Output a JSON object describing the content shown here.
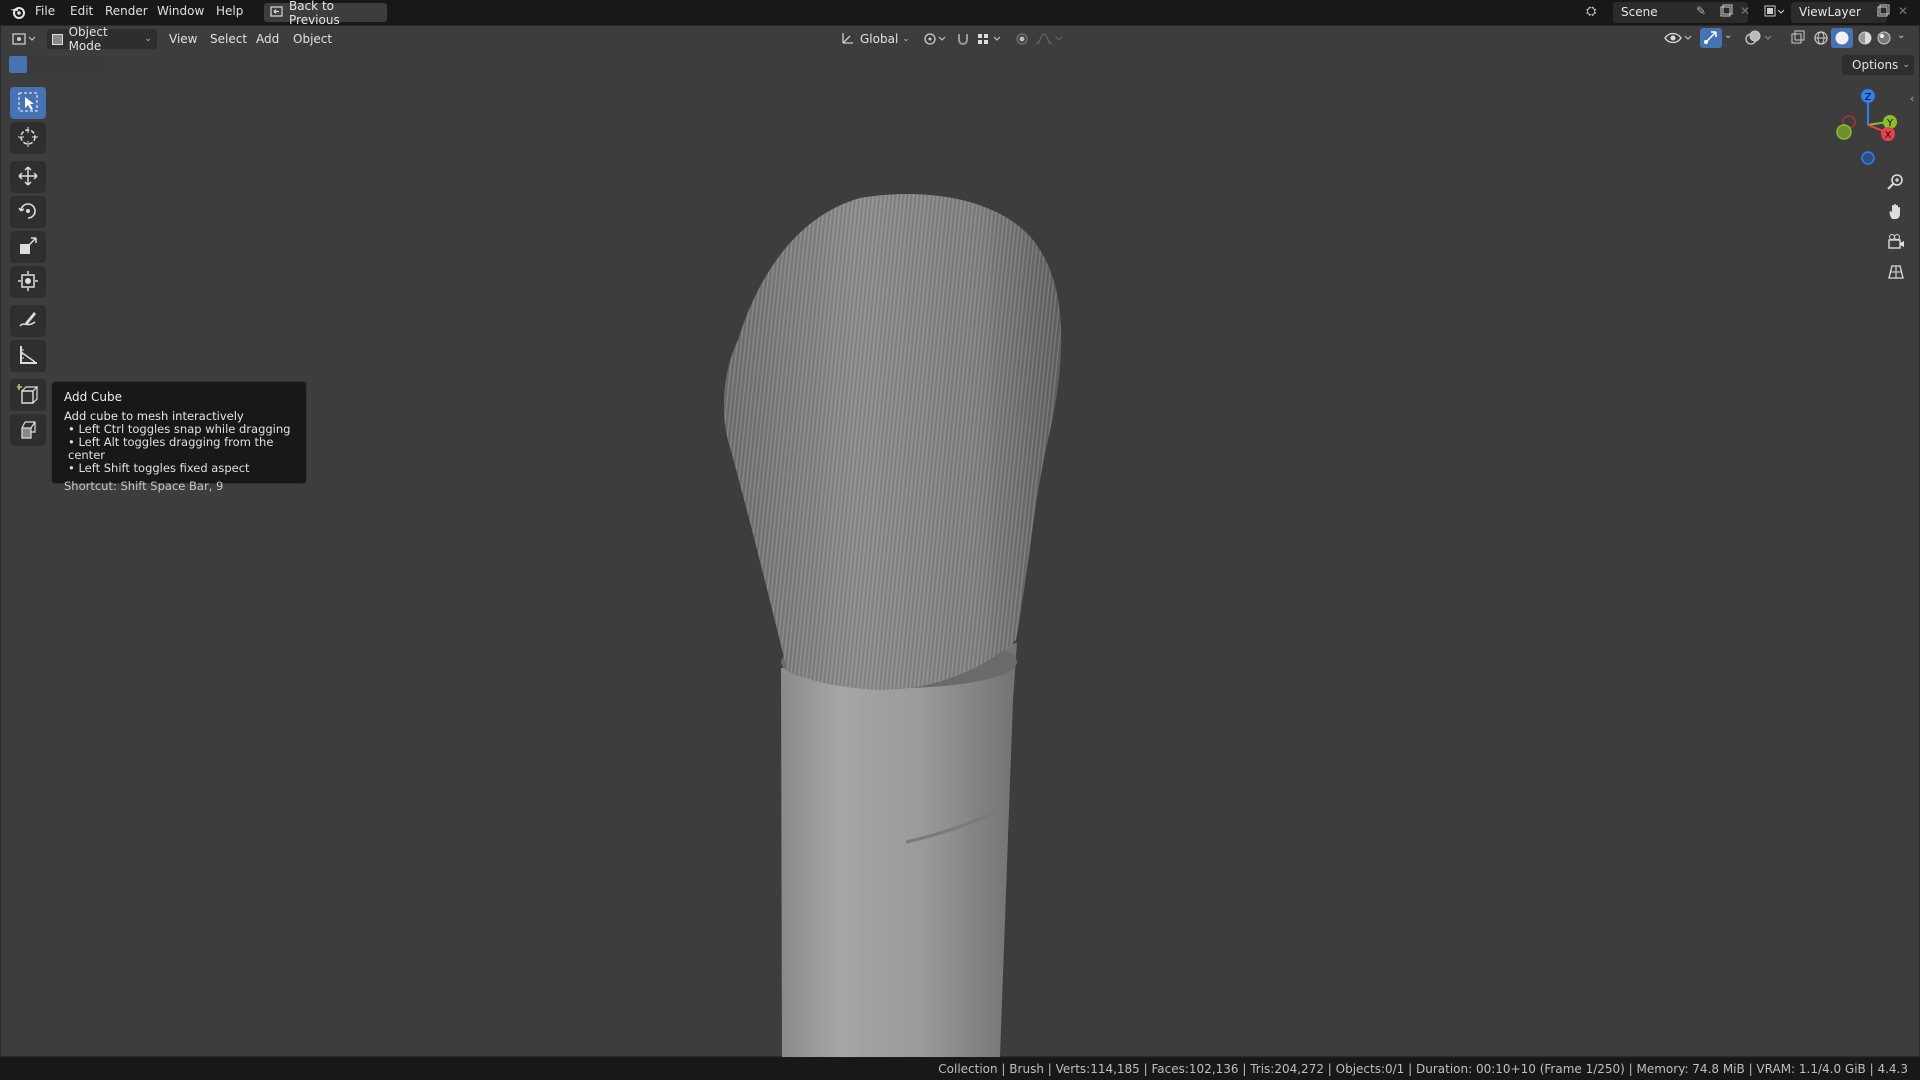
{
  "menu": {
    "file": "File",
    "edit": "Edit",
    "render": "Render",
    "window": "Window",
    "help": "Help",
    "back": "Back to Previous"
  },
  "scene": {
    "label": "Scene",
    "view_layer": "ViewLayer"
  },
  "header": {
    "mode": "Object Mode",
    "view": "View",
    "select": "Select",
    "add": "Add",
    "object": "Object",
    "orientation": "Global",
    "options": "Options"
  },
  "toolbar": {
    "tools": [
      "select-box",
      "cursor",
      "move",
      "rotate",
      "scale",
      "transform",
      "annotate",
      "measure",
      "add-cube",
      "add-cube-variant"
    ],
    "active": "select-box"
  },
  "tooltip": {
    "title": "Add Cube",
    "description": "Add cube to mesh interactively",
    "bullets": [
      "• Left Ctrl toggles snap while dragging",
      "• Left Alt toggles dragging from the center",
      "• Left Shift toggles fixed aspect"
    ],
    "shortcut": "Shortcut: Shift Space Bar, 9"
  },
  "gizmo": {
    "z": "Z",
    "y": "Y",
    "x": "X"
  },
  "status": {
    "text": "Collection | Brush | Verts:114,185 | Faces:102,136 | Tris:204,272 | Objects:0/1 | Duration: 00:10+10 (Frame 1/250) | Memory: 74.8 MiB | VRAM: 1.1/4.0 GiB | 4.4.3"
  },
  "colors": {
    "accent": "#4772b3",
    "viewport": "#3d3d3d",
    "axis_x": "#e8424e",
    "axis_y": "#8bbd2c",
    "axis_z": "#2f80ed"
  }
}
